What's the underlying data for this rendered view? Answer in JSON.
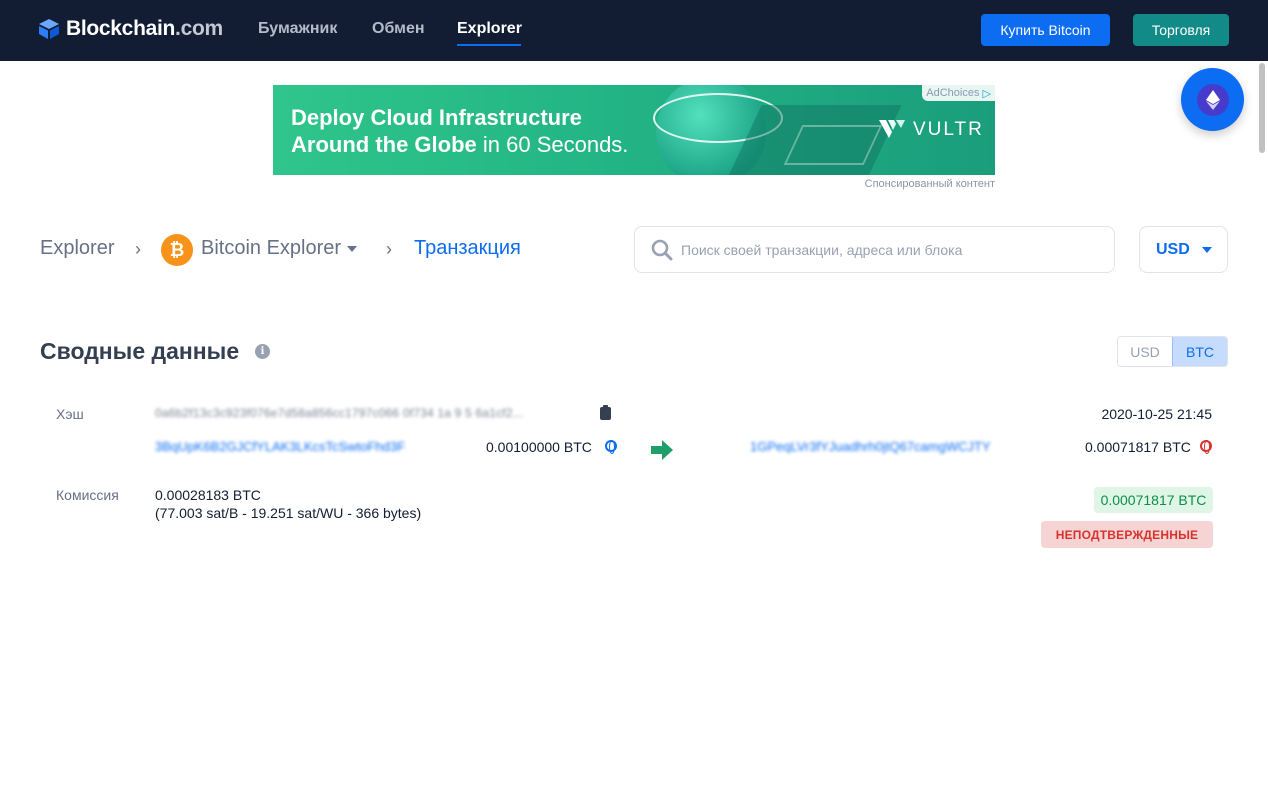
{
  "header": {
    "logo_text": "Blockchain",
    "logo_suffix": ".com",
    "nav": [
      "Бумажник",
      "Обмен",
      "Explorer"
    ],
    "buy_label": "Купить Bitcoin",
    "trade_label": "Торговля",
    "accent": "#0c6cf2"
  },
  "ad": {
    "line1": "Deploy Cloud Infrastructure",
    "line2_bold": "Around the Globe",
    "line2_rest": " in 60 Seconds.",
    "brand": "VULTR",
    "adchoices": "AdChoices",
    "sponsored": "Спонсированный контент"
  },
  "breadcrumb": {
    "root": "Explorer",
    "middle": "Bitcoin Explorer",
    "current": "Транзакция",
    "coin_symbol": "₿"
  },
  "search": {
    "placeholder": "Поиск своей транзакции, адреса или блока",
    "value": ""
  },
  "currency": {
    "selected": "USD"
  },
  "summary": {
    "title": "Сводные данные",
    "info_glyph": "i",
    "toggle": [
      "USD",
      "BTC"
    ],
    "toggle_selected": "BTC",
    "hash_label": "Хэш",
    "hash_value": "0a6b2f13c3c923f076e7d58a856cc1797c066 0f734 1a 9 5 6a1cf2...",
    "date": "2020-10-25 21:45",
    "input_address": "3BqUpK6B2GJCfYLAK3LKcsTcSwtoFhd3F",
    "input_amount": "0.00100000 BTC",
    "output_address": "1GPeqLVr3fYJuadhrh0jtQ67camgWCJTY",
    "output_amount": "0.00071817 BTC",
    "fee_label": "Комиссия",
    "fee_value": "0.00028183 BTC",
    "fee_detail": "(77.003 sat/B - 19.251 sat/WU - 366 bytes)",
    "total_output": "0.00071817 BTC",
    "status": "НЕПОДТВЕРЖДЕННЫЕ"
  }
}
